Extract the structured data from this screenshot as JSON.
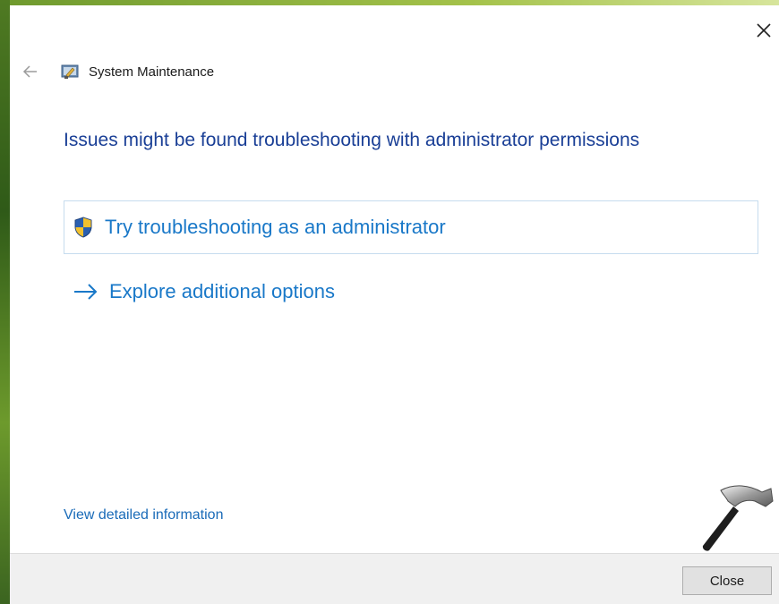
{
  "window": {
    "title": "System Maintenance",
    "close_icon": "close-icon",
    "back_icon": "back-arrow-icon"
  },
  "main": {
    "heading": "Issues might be found troubleshooting with administrator permissions",
    "options": [
      {
        "label": "Try troubleshooting as an administrator",
        "icon": "uac-shield-icon"
      },
      {
        "label": "Explore additional options",
        "icon": "arrow-right-icon"
      }
    ],
    "detail_link": "View detailed information"
  },
  "footer": {
    "close_label": "Close"
  },
  "colors": {
    "heading": "#1a3f96",
    "link": "#1978c8",
    "footer_bg": "#f0f0f0"
  }
}
